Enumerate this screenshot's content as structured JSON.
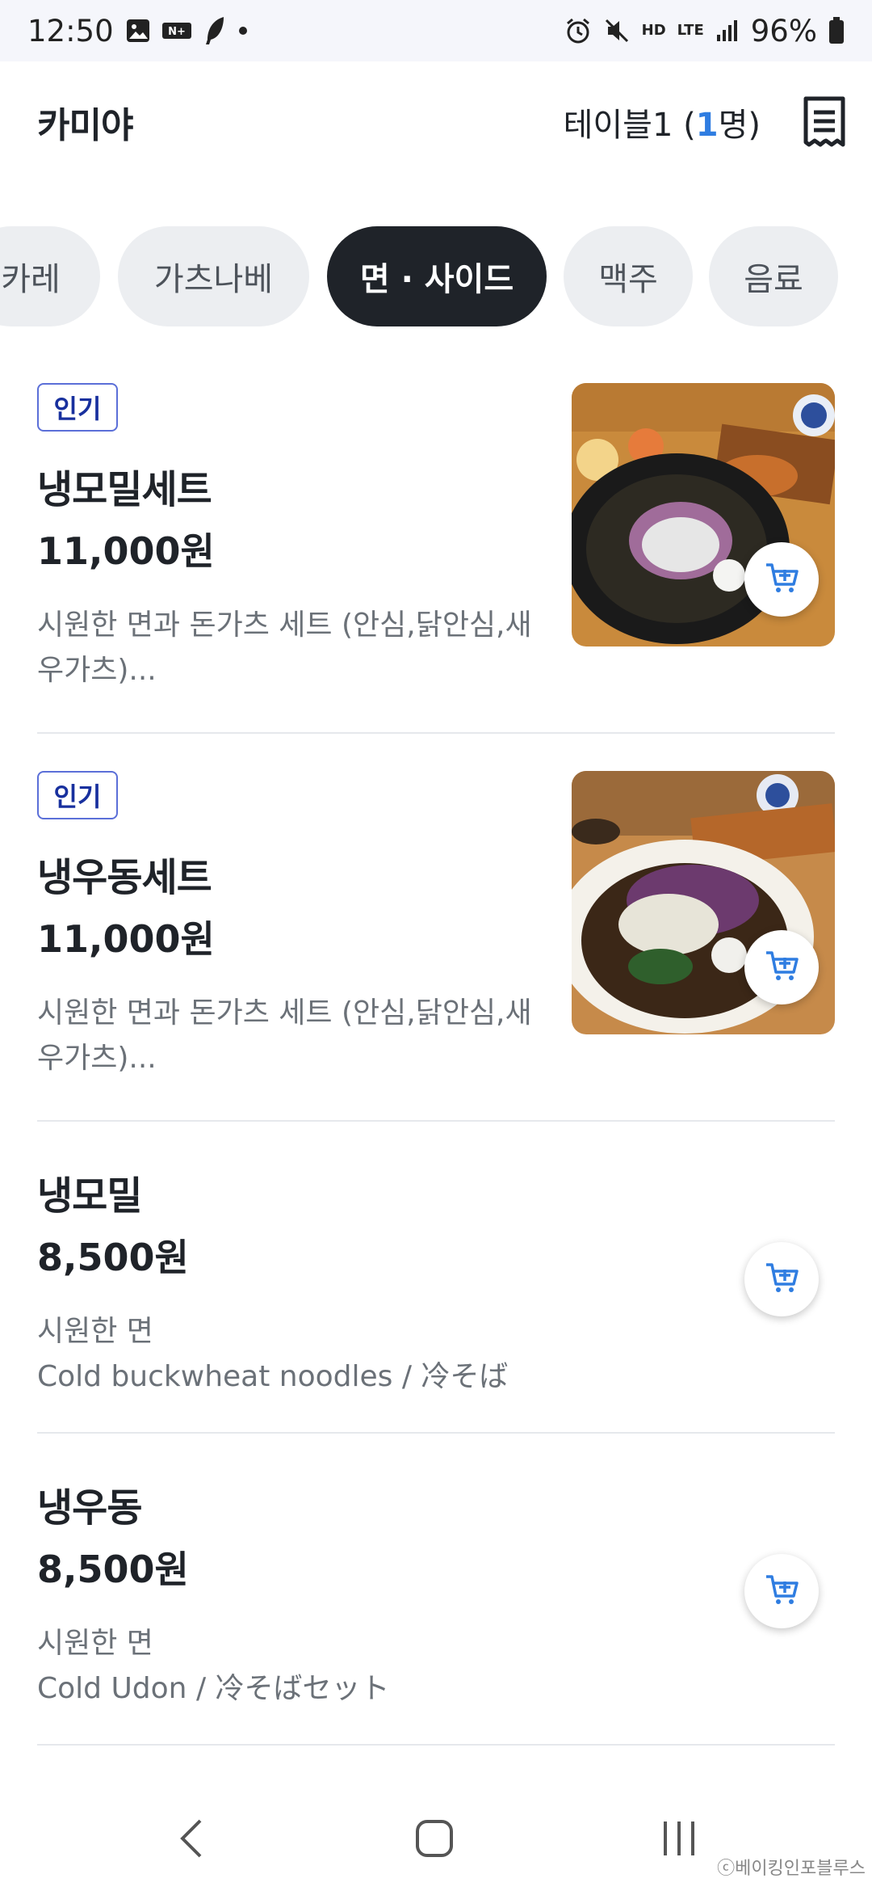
{
  "status_bar": {
    "time": "12:50",
    "small_icon_text_1": "HD",
    "small_icon_text_2": "LTE",
    "battery": "96%"
  },
  "header": {
    "store_name": "카미야",
    "table_label": "테이블1 (",
    "table_count": "1",
    "table_suffix": "명)"
  },
  "tabs": [
    {
      "label": "카레"
    },
    {
      "label": "가츠나베"
    },
    {
      "label": "면 · 사이드"
    },
    {
      "label": "맥주"
    },
    {
      "label": "음료"
    }
  ],
  "items": [
    {
      "badge": "인기",
      "name": "냉모밀세트",
      "price": "11,000원",
      "desc": "시원한 면과 돈가츠 세트 (안심,닭안심,새우가츠)..."
    },
    {
      "badge": "인기",
      "name": "냉우동세트",
      "price": "11,000원",
      "desc": "시원한 면과 돈가츠 세트 (안심,닭안심,새우가츠)..."
    },
    {
      "name": "냉모밀",
      "price": "8,500원",
      "desc_line1": "시원한 면",
      "desc_line2": "Cold buckwheat noodles / 冷そば"
    },
    {
      "name": "냉우동",
      "price": "8,500원",
      "desc_line1": "시원한 면",
      "desc_line2": "Cold Udon / 冷そばセット"
    }
  ],
  "watermark": "ⓒ베이킹인포블루스",
  "colors": {
    "accent": "#2f7de1",
    "tab_active": "#1f2329",
    "badge": "#18309e"
  }
}
